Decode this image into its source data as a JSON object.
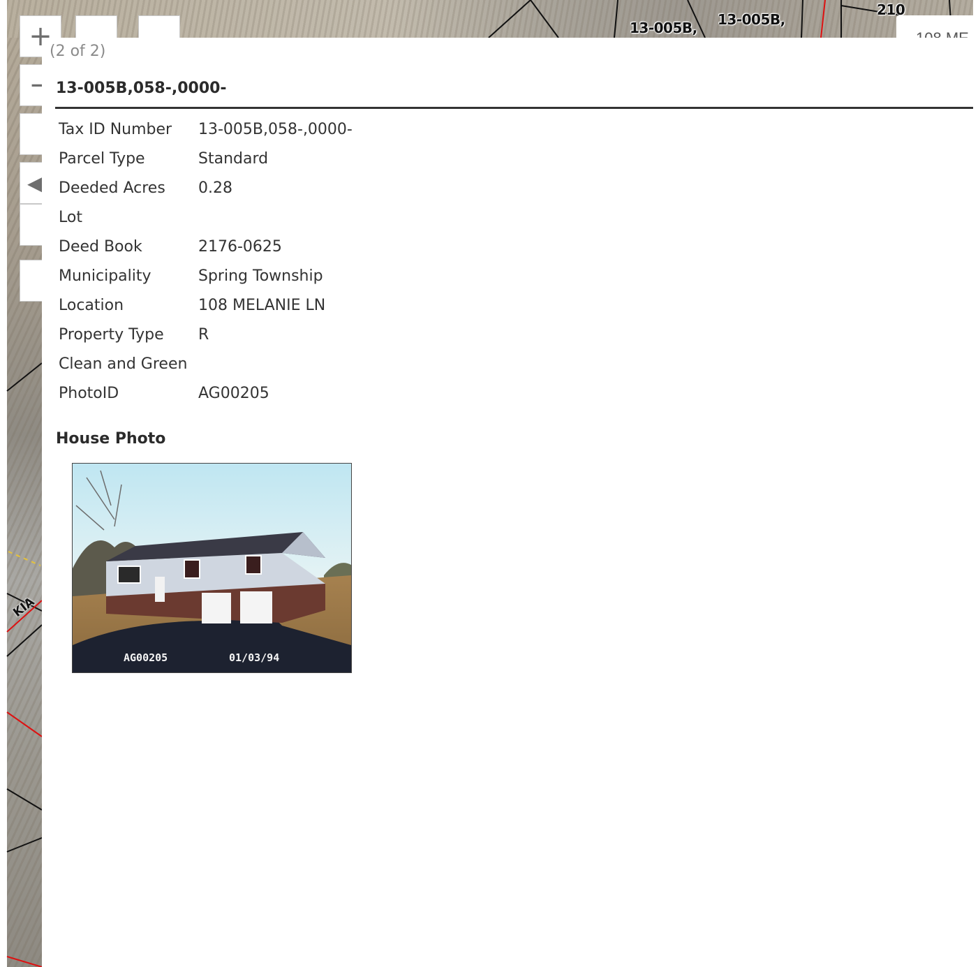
{
  "map": {
    "parcel_labels": [
      "13-005B,",
      "13-005B,",
      "210"
    ],
    "street_label": "KIA",
    "controls": {
      "zoom_in": "+",
      "zoom_out": "−"
    },
    "search_value": "108 ME"
  },
  "popup": {
    "pager": "(2 of 2)",
    "title": "13-005B,058-,0000-",
    "attributes": [
      {
        "key": "Tax ID Number",
        "value": "13-005B,058-,0000-"
      },
      {
        "key": "Parcel Type",
        "value": "Standard"
      },
      {
        "key": "Deeded Acres",
        "value": "0.28"
      },
      {
        "key": "Lot",
        "value": ""
      },
      {
        "key": "Deed Book",
        "value": "2176-0625"
      },
      {
        "key": "Municipality",
        "value": "Spring Township"
      },
      {
        "key": "Location",
        "value": "108 MELANIE LN"
      },
      {
        "key": "Property Type",
        "value": "R"
      },
      {
        "key": "Clean and Green",
        "value": ""
      },
      {
        "key": "PhotoID",
        "value": "AG00205"
      }
    ],
    "photo_section_title": "House Photo",
    "photo": {
      "caption_id": "AG00205",
      "caption_date": "01/03/94"
    }
  }
}
